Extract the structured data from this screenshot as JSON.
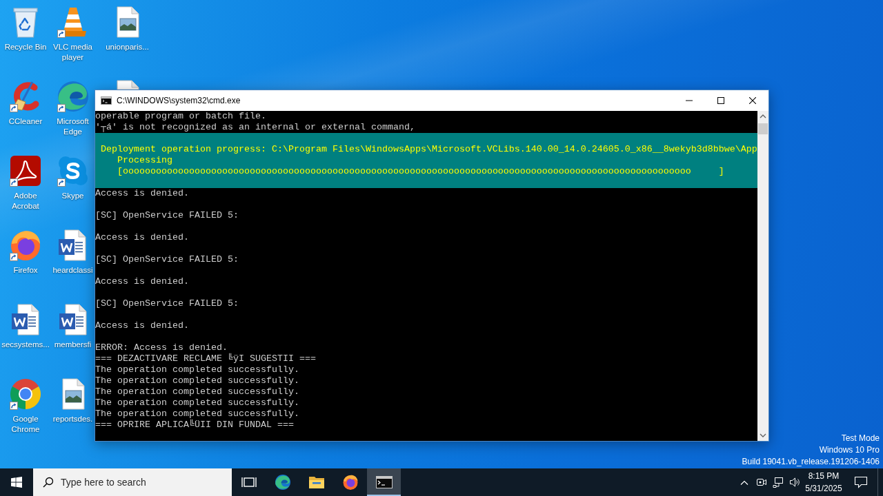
{
  "desktop_icons": [
    {
      "label": "Recycle Bin",
      "kind": "recycle-bin",
      "shortcut": false
    },
    {
      "label": "CCleaner",
      "kind": "ccleaner",
      "shortcut": true
    },
    {
      "label": "Adobe Acrobat",
      "kind": "acrobat",
      "shortcut": true
    },
    {
      "label": "Firefox",
      "kind": "firefox",
      "shortcut": true
    },
    {
      "label": "secsystems...",
      "kind": "word-document",
      "shortcut": false
    },
    {
      "label": "Google Chrome",
      "kind": "chrome",
      "shortcut": true
    },
    {
      "label": "VLC media player",
      "kind": "vlc",
      "shortcut": true
    },
    {
      "label": "Microsoft Edge",
      "kind": "edge",
      "shortcut": true
    },
    {
      "label": "Skype",
      "kind": "skype",
      "shortcut": true
    },
    {
      "label": "heardclassi",
      "kind": "word-document",
      "shortcut": false
    },
    {
      "label": "membersfi",
      "kind": "word-document",
      "shortcut": false
    },
    {
      "label": "reportsdes.",
      "kind": "image-file",
      "shortcut": false
    },
    {
      "label": "unionparis...",
      "kind": "image-file",
      "shortcut": false
    },
    {
      "kind": "covered-file",
      "shortcut": false
    }
  ],
  "console_window": {
    "title": "C:\\WINDOWS\\system32\\cmd.exe",
    "lines": [
      "operable program or batch file.",
      "'┬á' is not recognized as an internal or external command,"
    ],
    "progress": {
      "activity": "Deployment operation progress: C:\\Program Files\\WindowsApps\\Microsoft.VCLibs.140.00_14.0.24605.0_x86__8wekyb3d8bbwe\\App",
      "status": "Processing",
      "bar": "[ooooooooooooooooooooooooooooooooooooooooooooooooooooooooooooooooooooooooooooooooooooooooooooooooooooooo     ]"
    },
    "output_blocks": [
      [
        "Access is denied."
      ],
      [
        "[SC] OpenService FAILED 5:"
      ],
      [
        "Access is denied."
      ],
      [
        "[SC] OpenService FAILED 5:"
      ],
      [
        "Access is denied."
      ],
      [
        "[SC] OpenService FAILED 5:"
      ],
      [
        "Access is denied."
      ],
      [
        "ERROR: Access is denied.",
        "=== DEZACTIVARE RECLAME ╚ÿI SUGESTII ===",
        "The operation completed successfully.",
        "The operation completed successfully.",
        "The operation completed successfully.",
        "The operation completed successfully.",
        "The operation completed successfully.",
        "=== OPRIRE APLICA╚ÜII DIN FUNDAL ==="
      ]
    ]
  },
  "desktop_watermark": [
    "Test Mode",
    "Windows 10 Pro",
    "Build 19041.vb_release.191206-1406"
  ],
  "taskbar": {
    "search": {
      "placeholder": "Type here to search"
    },
    "apps": [
      {
        "kind": "task-view",
        "active": false
      },
      {
        "kind": "edge",
        "active": false
      },
      {
        "kind": "file-explorer",
        "active": false
      },
      {
        "kind": "firefox",
        "active": false
      },
      {
        "kind": "terminal",
        "active": true
      }
    ],
    "clock": {
      "time": "8:15 PM",
      "date": "5/31/2025"
    }
  }
}
